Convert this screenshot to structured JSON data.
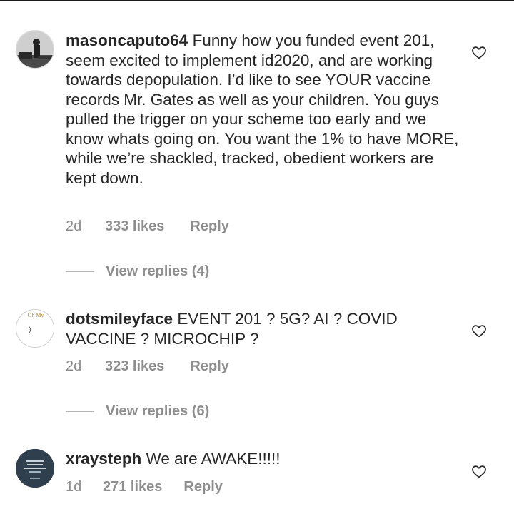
{
  "comments": [
    {
      "username": "masoncaputo64",
      "text": " Funny how you funded event 201, seem excited to implement id2020, and are working towards depopulation.  I’d like to see YOUR vaccine records Mr. Gates as well as your children.  You guys pulled the trigger on your scheme too early and we know whats going on.  You want the 1% to have MORE, while we’re shackled, tracked, obedient workers are kept down.",
      "time": "2d",
      "likes": "333 likes",
      "reply_label": "Reply",
      "view_replies": "View replies (4)",
      "icon": "heart-outline-icon"
    },
    {
      "username": "dotsmileyface",
      "text": " EVENT 201 ? 5G? AI ? COVID VACCINE ? MICROCHIP ?",
      "time": "2d",
      "likes": "323 likes",
      "reply_label": "Reply",
      "view_replies": "View replies (6)",
      "avatar_text_top": "Oh My",
      "avatar_text_center": ":)",
      "icon": "heart-outline-icon"
    },
    {
      "username": "xraysteph",
      "text": " We are AWAKE!!!!!",
      "time": "1d",
      "likes": "271 likes",
      "reply_label": "Reply",
      "icon": "heart-outline-icon"
    }
  ],
  "colors": {
    "text": "#262626",
    "meta": "#8e8e8e",
    "avatar3_bg": "#2f3f4d"
  }
}
